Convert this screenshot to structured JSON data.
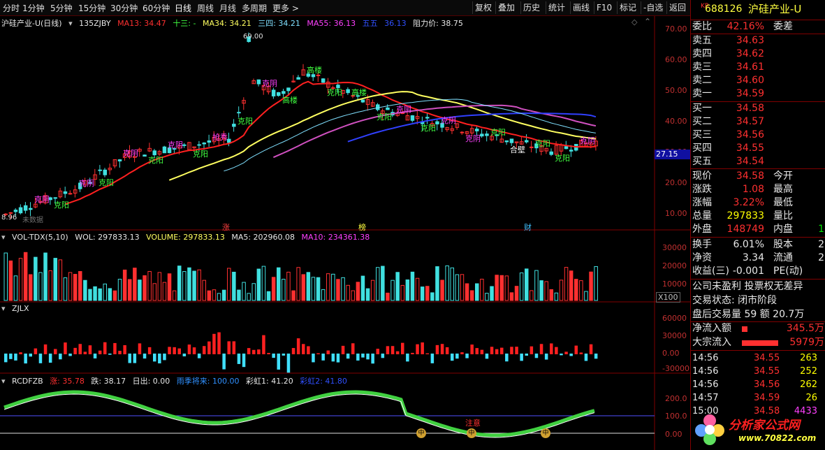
{
  "toolbar": {
    "periods": [
      "分时",
      "1分钟",
      "5分钟",
      "15分钟",
      "30分钟",
      "60分钟",
      "日线",
      "周线",
      "月线",
      "多周期",
      "更多 >"
    ],
    "active_period": "日线",
    "right_buttons": [
      "复权",
      "叠加",
      "历史",
      "统计",
      "画线",
      "F10",
      "标记",
      "-自选",
      "返回"
    ]
  },
  "main_chart": {
    "legend": {
      "title": "沪硅产业-U(日线)",
      "indicator": "135ZJBY",
      "ma13": "MA13: 34.47",
      "t13": "十三: -",
      "ma34": "MA34: 34.21",
      "t34": "三四: 34.21",
      "ma55": "MA55: 36.13",
      "t55": "五五",
      "v55": "36.13",
      "resist": "阻力价: 38.75"
    },
    "axis": [
      "70.00",
      "60.00",
      "50.00",
      "40.00",
      "30.00",
      "20.00",
      "10.00"
    ],
    "price_tag": "27.15",
    "high_label": "69.00",
    "low_label": "8.96",
    "no_data": "未数据",
    "markers": [
      "涨",
      "榜",
      "财"
    ],
    "annotations": [
      {
        "t": "克阴",
        "c": "#ff40ff"
      },
      {
        "t": "克阳",
        "c": "#40ff40"
      },
      {
        "t": "克阴",
        "c": "#ff40ff"
      },
      {
        "t": "克阳",
        "c": "#40ff40"
      },
      {
        "t": "克阴",
        "c": "#ff40ff"
      },
      {
        "t": "克阳",
        "c": "#40ff40"
      },
      {
        "t": "克阴",
        "c": "#ff40ff"
      },
      {
        "t": "克阳",
        "c": "#40ff40"
      },
      {
        "t": "抢秀",
        "c": "#ff40ff"
      },
      {
        "t": "克阳",
        "c": "#40ff40"
      },
      {
        "t": "克阴",
        "c": "#ff40ff"
      },
      {
        "t": "高楼",
        "c": "#40ff40"
      },
      {
        "t": "高楼",
        "c": "#40ff40"
      },
      {
        "t": "克阳",
        "c": "#40ff40"
      },
      {
        "t": "高楼",
        "c": "#40ff40"
      },
      {
        "t": "克阳",
        "c": "#40ff40"
      },
      {
        "t": "克阴",
        "c": "#ff40ff"
      },
      {
        "t": "克阳",
        "c": "#40ff40"
      },
      {
        "t": "克阴",
        "c": "#ff40ff"
      },
      {
        "t": "克阴",
        "c": "#ff40ff"
      },
      {
        "t": "克阳",
        "c": "#40ff40"
      },
      {
        "t": "合壁",
        "c": "#ffffff"
      },
      {
        "t": "克阳",
        "c": "#40ff40"
      },
      {
        "t": "克阳",
        "c": "#40ff40"
      },
      {
        "t": "克阴",
        "c": "#ff40ff"
      }
    ]
  },
  "vol_chart": {
    "legend": {
      "name": "VOL-TDX(5,10)",
      "wol": "WOL: 297833.13",
      "volume": "VOLUME: 297833.13",
      "ma5": "MA5: 202960.08",
      "ma10": "MA10: 234361.38"
    },
    "axis": [
      "30000",
      "20000",
      "10000"
    ],
    "unit": "X100"
  },
  "zjlx_chart": {
    "legend": {
      "name": "ZJLX"
    },
    "axis": [
      "60000",
      "30000",
      "0.00",
      "-30000"
    ]
  },
  "rcd_chart": {
    "legend": {
      "name": "RCDFZB",
      "zhang": "涨: 35.78",
      "die": "跌: 38.17",
      "richu": "日出: 0.00",
      "yuji": "雨季将来: 100.00",
      "caihong1": "彩虹1: 41.20",
      "caihong2": "彩虹2: 41.80"
    },
    "axis": [
      "200.0",
      "100.0",
      "0.00"
    ],
    "notice": "注意",
    "markers": [
      "中",
      "中",
      "中"
    ]
  },
  "panel": {
    "market": "KR",
    "code": "688126",
    "name": "沪硅产业-U",
    "weibi_label": "委比",
    "weibi_value": "42.16%",
    "weicha_label": "委差",
    "asks": [
      {
        "label": "卖五",
        "price": "34.63"
      },
      {
        "label": "卖四",
        "price": "34.62"
      },
      {
        "label": "卖三",
        "price": "34.61"
      },
      {
        "label": "卖二",
        "price": "34.60"
      },
      {
        "label": "卖一",
        "price": "34.59"
      }
    ],
    "bids": [
      {
        "label": "买一",
        "price": "34.58"
      },
      {
        "label": "买二",
        "price": "34.57"
      },
      {
        "label": "买三",
        "price": "34.56"
      },
      {
        "label": "买四",
        "price": "34.55"
      },
      {
        "label": "买五",
        "price": "34.54"
      }
    ],
    "quote": [
      {
        "l": "现价",
        "v": "34.58",
        "vc": "red",
        "l2": "今开"
      },
      {
        "l": "涨跌",
        "v": "1.08",
        "vc": "red",
        "l2": "最高"
      },
      {
        "l": "涨幅",
        "v": "3.22%",
        "vc": "red",
        "l2": "最低"
      },
      {
        "l": "总量",
        "v": "297833",
        "vc": "yellow",
        "l2": "量比"
      },
      {
        "l": "外盘",
        "v": "148749",
        "vc": "red",
        "l2": "内盘",
        "v2": "1",
        "v2c": "green"
      }
    ],
    "stats": [
      {
        "l": "换手",
        "v": "6.01%",
        "l2": "股本",
        "v2": "2"
      },
      {
        "l": "净资",
        "v": "3.34",
        "l2": "流通",
        "v2": "2"
      },
      {
        "l": "收益(三)",
        "v": "-0.001",
        "l2": "PE(动)",
        "v2": ""
      }
    ],
    "notes": [
      "公司未盈利 投票权无差异",
      "交易状态: 闭市阶段",
      "盘后交易量 59 额 20.7万"
    ],
    "netflow_label": "净流入额",
    "netflow_value": "345.5万",
    "block_label": "大宗流入",
    "block_value": "5979万",
    "ticks": [
      {
        "t": "14:56",
        "p": "34.55",
        "v": "263",
        "vc": "yellow"
      },
      {
        "t": "14:56",
        "p": "34.55",
        "v": "252",
        "vc": "yellow"
      },
      {
        "t": "14:56",
        "p": "34.56",
        "v": "262",
        "vc": "yellow"
      },
      {
        "t": "14:57",
        "p": "34.59",
        "v": "26",
        "vc": "yellow"
      },
      {
        "t": "15:00",
        "p": "34.58",
        "v": "4433",
        "vc": "magenta"
      }
    ],
    "watermark_url": "www.70822.com",
    "watermark_title": "分析家公式网"
  },
  "colors": {
    "up": "#ff3030",
    "down": "#40e0e0",
    "ma13": "#ff2020",
    "ma34": "#ffff60",
    "ma55": "#d050c0",
    "ma_blue": "#3040ff",
    "ma_cyan": "#80e0ff"
  }
}
